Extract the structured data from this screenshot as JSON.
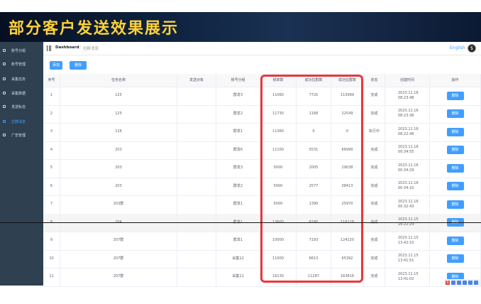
{
  "banner": {
    "title": "部分客户发送效果展示"
  },
  "sidebar": {
    "items": [
      {
        "label": "账号分组",
        "icon": "user-icon"
      },
      {
        "label": "账号管理",
        "icon": "user-icon"
      },
      {
        "label": "采集任务",
        "icon": "gear-icon"
      },
      {
        "label": "采集数据",
        "icon": "gear-icon"
      },
      {
        "label": "发送私信",
        "icon": "gear-icon"
      },
      {
        "label": "拉群消息",
        "icon": "gear-icon"
      },
      {
        "label": "广告管理",
        "icon": "gear-icon"
      }
    ],
    "active_index": 5,
    "bg_color": "#2f4050",
    "active_color": "#409eff"
  },
  "header": {
    "breadcrumb_home": "Dashboard",
    "breadcrumb_separator": "/",
    "breadcrumb_current": "拉群消息",
    "language_link": "English",
    "avatar_glyph": "$"
  },
  "toolbar": {
    "add_label": "添加",
    "delete_label": "删除"
  },
  "table": {
    "columns": [
      "序号",
      "任务名称",
      "发送对象",
      "账号分组",
      "频率数",
      "成功拉群数",
      "成功拉群数",
      "状态",
      "创建时间",
      "操作"
    ],
    "rows": [
      {
        "no": "1",
        "task": "125",
        "target": "",
        "group": "群发3",
        "freq": "11060",
        "success_groups": "7720",
        "success_count": "115999",
        "status": "完成",
        "created": "2023.11.16 08:23:48",
        "action": "删除"
      },
      {
        "no": "2",
        "task": "125",
        "target": "",
        "group": "群发2",
        "freq": "11730",
        "success_groups": "1168",
        "success_count": "22549",
        "status": "完成",
        "created": "2023.11.16 08:23:36",
        "action": "删除"
      },
      {
        "no": "3",
        "task": "126",
        "target": "",
        "group": "群发1",
        "freq": "11360",
        "success_groups": "0",
        "success_count": "0",
        "status": "执行中",
        "created": "2023.11.16 08:22:48",
        "action": "删除"
      },
      {
        "no": "4",
        "task": "203",
        "target": "",
        "group": "群发6",
        "freq": "11100",
        "success_groups": "5531",
        "success_count": "66999",
        "status": "完成",
        "created": "2023.11.16 00:34:55",
        "action": "删除"
      },
      {
        "no": "5",
        "task": "203",
        "target": "",
        "group": "群发3",
        "freq": "5000",
        "success_groups": "2005",
        "success_count": "29038",
        "status": "完成",
        "created": "2023.11.16 00:34:29",
        "action": "删除"
      },
      {
        "no": "6",
        "task": "203",
        "target": "",
        "group": "群发2",
        "freq": "5000",
        "success_groups": "2577",
        "success_count": "38413",
        "status": "完成",
        "created": "2023.11.16 00:34:10",
        "action": "删除"
      },
      {
        "no": "7",
        "task": "203群",
        "target": "",
        "group": "群发1",
        "freq": "5000",
        "success_groups": "1390",
        "success_count": "25970",
        "status": "完成",
        "created": "2023.11.16 00:32:43",
        "action": "删除"
      },
      {
        "no": "8",
        "task": "204",
        "target": "",
        "group": "群发1",
        "freq": "13600",
        "success_groups": "6180",
        "success_count": "116118",
        "status": "完成",
        "created": "2023.11.15 16:22:29",
        "action": "删除"
      },
      {
        "no": "9",
        "task": "207群",
        "target": "",
        "group": "群发1",
        "freq": "10000",
        "success_groups": "7193",
        "success_count": "124220",
        "status": "完成",
        "created": "2023.11.15 13:42:10",
        "action": "删除"
      },
      {
        "no": "10",
        "task": "207群",
        "target": "",
        "group": "采集12",
        "freq": "11000",
        "success_groups": "6613",
        "success_count": "65392",
        "status": "完成",
        "created": "2023.11.15 13:41:51",
        "action": "删除"
      },
      {
        "no": "11",
        "task": "207群",
        "target": "",
        "group": "采集11",
        "freq": "16130",
        "success_groups": "11287",
        "success_count": "163616",
        "status": "完成",
        "created": "2023.11.15 13:41:02",
        "action": "删除"
      }
    ]
  },
  "highlight_color": "#e8383d",
  "ime": {
    "logo": "S"
  }
}
